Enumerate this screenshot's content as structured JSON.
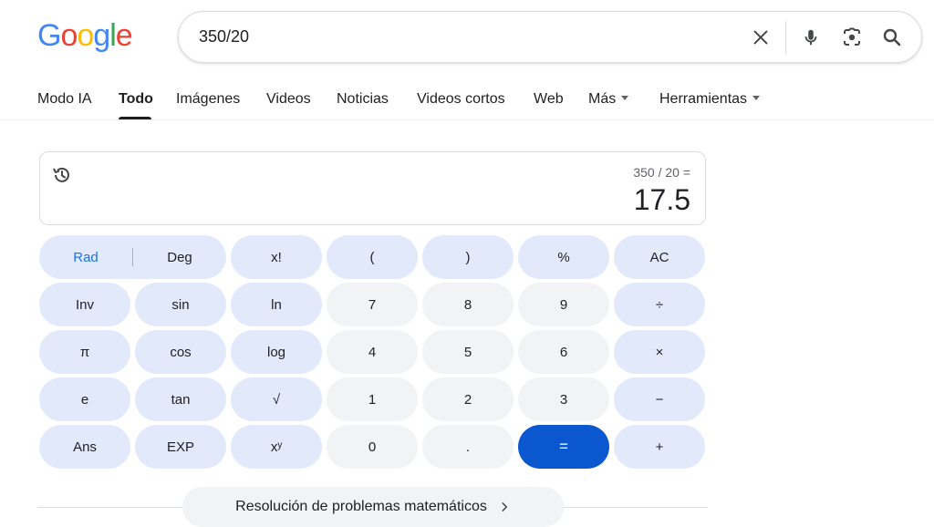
{
  "logo": {
    "letters": [
      {
        "ch": "G",
        "color": "#4285f4"
      },
      {
        "ch": "o",
        "color": "#ea4335"
      },
      {
        "ch": "o",
        "color": "#fbbc05"
      },
      {
        "ch": "g",
        "color": "#4285f4"
      },
      {
        "ch": "l",
        "color": "#34a853"
      },
      {
        "ch": "e",
        "color": "#ea4335"
      }
    ]
  },
  "search": {
    "query": "350/20",
    "icons": [
      "close-icon",
      "microphone-icon",
      "lens-icon",
      "search-icon"
    ]
  },
  "tabs": [
    {
      "label": "Modo IA",
      "active": false
    },
    {
      "label": "Todo",
      "active": true
    },
    {
      "label": "Imágenes",
      "active": false
    },
    {
      "label": "Videos",
      "active": false
    },
    {
      "label": "Noticias",
      "active": false
    },
    {
      "label": "Videos cortos",
      "active": false
    },
    {
      "label": "Web",
      "active": false
    },
    {
      "label": "Más",
      "active": false,
      "dropdown": true
    },
    {
      "label": "Herramientas",
      "active": false,
      "dropdown": true
    }
  ],
  "calculator": {
    "expression": "350 / 20 =",
    "result": "17.5",
    "mode": {
      "rad": "Rad",
      "deg": "Deg"
    },
    "keys": [
      [
        "x!",
        "(",
        ")",
        "%",
        "AC"
      ],
      [
        "Inv",
        "sin",
        "ln",
        "7",
        "8",
        "9",
        "÷"
      ],
      [
        "π",
        "cos",
        "log",
        "4",
        "5",
        "6",
        "×"
      ],
      [
        "e",
        "tan",
        "√",
        "1",
        "2",
        "3",
        "−"
      ],
      [
        "Ans",
        "EXP",
        "xʸ",
        "0",
        ".",
        "=",
        "+"
      ]
    ]
  },
  "footer": {
    "solver_label": "Resolución de problemas matemáticos"
  },
  "colors": {
    "accent": "#0b57d0",
    "fn_key": "#e2e9fb",
    "num_key": "#f1f3f4"
  }
}
